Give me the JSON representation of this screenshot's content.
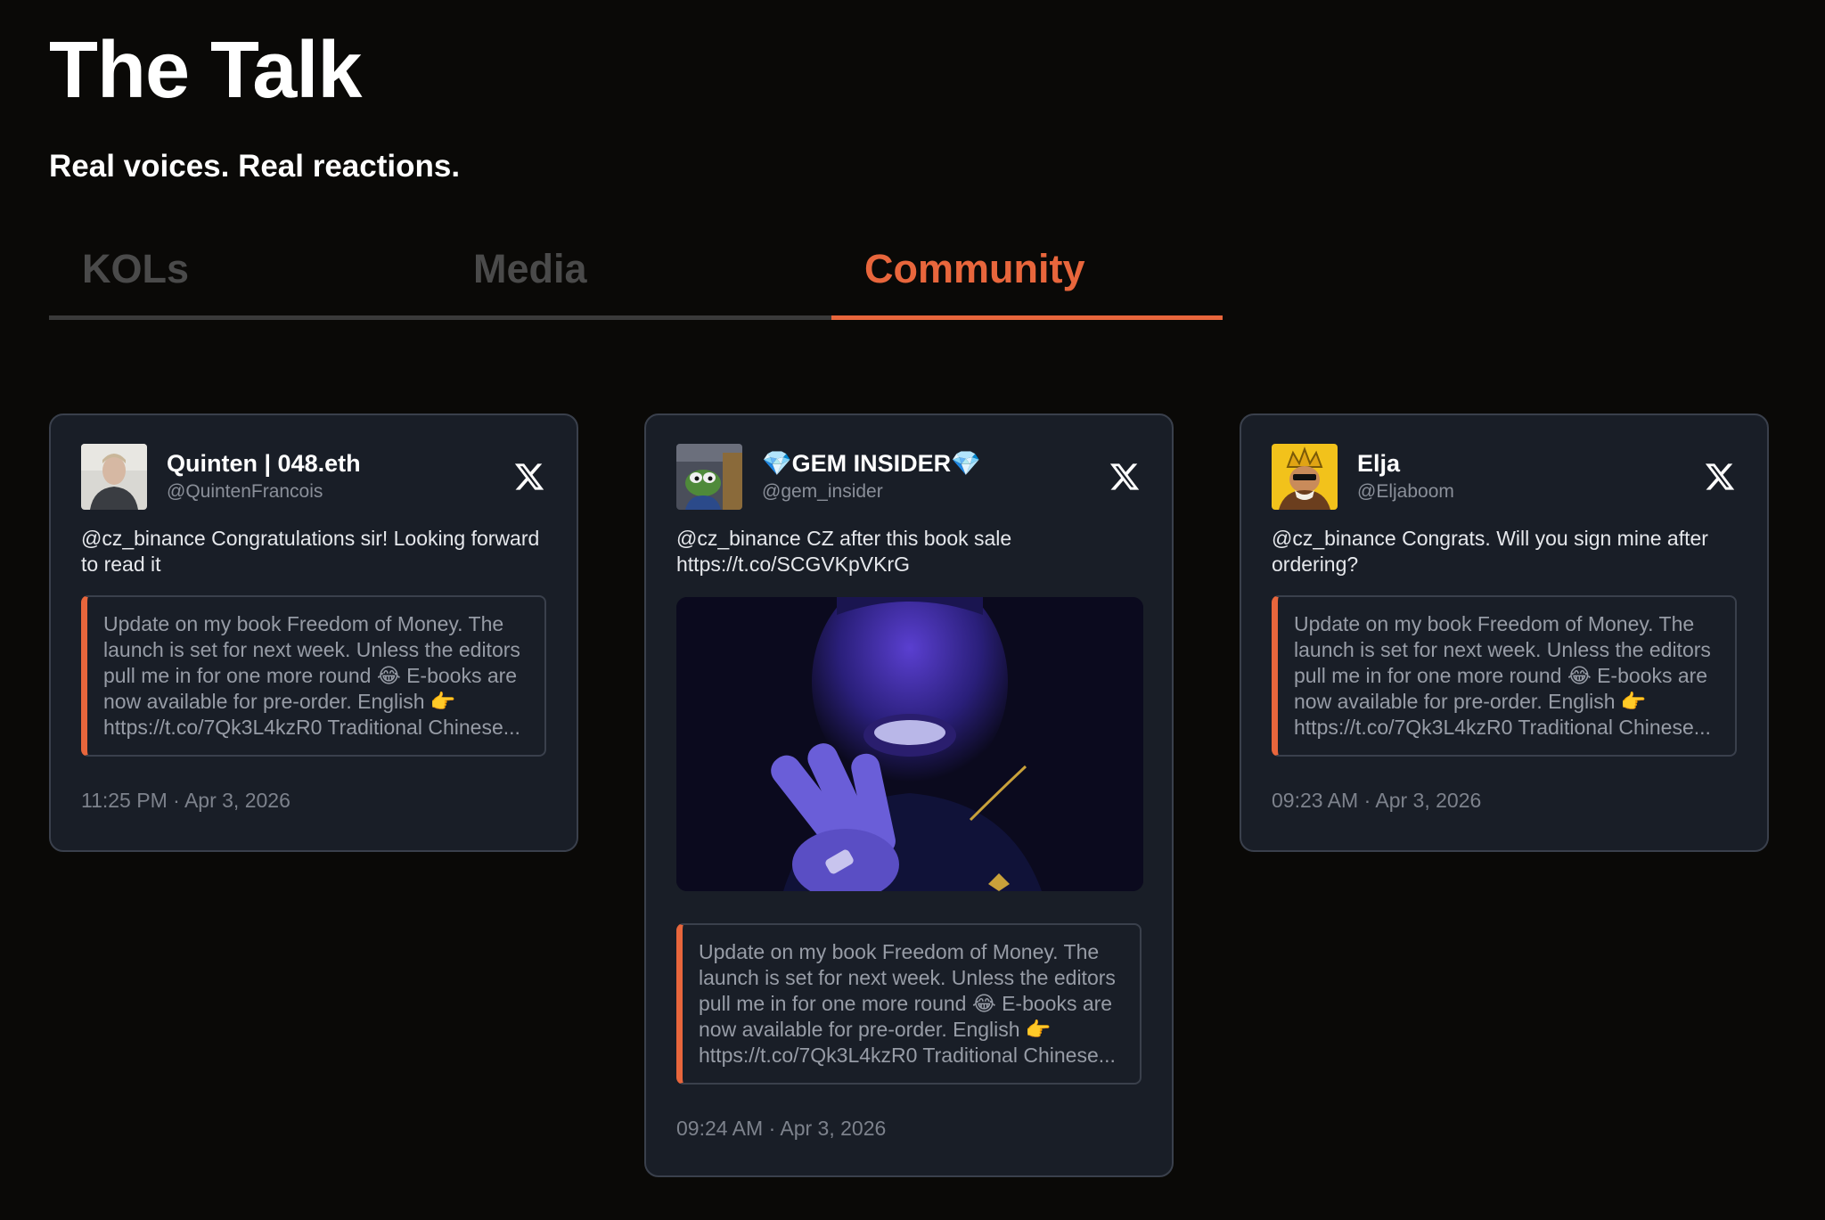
{
  "header": {
    "title": "The Talk",
    "subtitle": "Real voices. Real reactions."
  },
  "tabs": [
    {
      "label": "KOLs",
      "active": false
    },
    {
      "label": "Media",
      "active": false
    },
    {
      "label": "Community",
      "active": true
    }
  ],
  "colors": {
    "accent": "#e8663c",
    "background": "#0a0907",
    "card": "#191e27",
    "card_border": "#3a404c"
  },
  "cards": [
    {
      "name": "Quinten | 048.eth",
      "handle": "@QuintenFrancois",
      "avatar_icon": "man-portrait-avatar",
      "platform_icon": "x-logo-icon",
      "text": "@cz_binance Congratulations sir! Looking forward to read it",
      "quote_lines": [
        "Update on my book Freedom of Money. The",
        "launch is set for next week. Unless the editors",
        "pull me in for one more round 😂 E-books are",
        "now available for pre-order. English 👉",
        "https://t.co/7Qk3L4kzR0 Traditional Chinese..."
      ],
      "time": "11:25 PM",
      "separator": "·",
      "date": "Apr 3, 2026"
    },
    {
      "name": "💎GEM INSIDER💎",
      "handle": "@gem_insider",
      "avatar_icon": "pepe-frog-avatar",
      "platform_icon": "x-logo-icon",
      "text": "@cz_binance CZ after this book sale https://t.co/SCGVKpVKrG",
      "media_icon": "smiling-man-purple-photo",
      "quote_lines": [
        "Update on my book Freedom of Money. The",
        "launch is set for next week. Unless the editors",
        "pull me in for one more round 😂 E-books are",
        "now available for pre-order. English 👉",
        "https://t.co/7Qk3L4kzR0 Traditional Chinese..."
      ],
      "time": "09:24 AM",
      "separator": "·",
      "date": "Apr 3, 2026"
    },
    {
      "name": "Elja",
      "handle": "@Eljaboom",
      "avatar_icon": "crowned-character-avatar",
      "platform_icon": "x-logo-icon",
      "text": "@cz_binance Congrats. Will you sign mine after ordering?",
      "quote_lines": [
        "Update on my book Freedom of Money. The",
        "launch is set for next week. Unless the editors",
        "pull me in for one more round 😂 E-books are",
        "now available for pre-order. English 👉",
        "https://t.co/7Qk3L4kzR0 Traditional Chinese..."
      ],
      "time": "09:23 AM",
      "separator": "·",
      "date": "Apr 3, 2026"
    }
  ]
}
